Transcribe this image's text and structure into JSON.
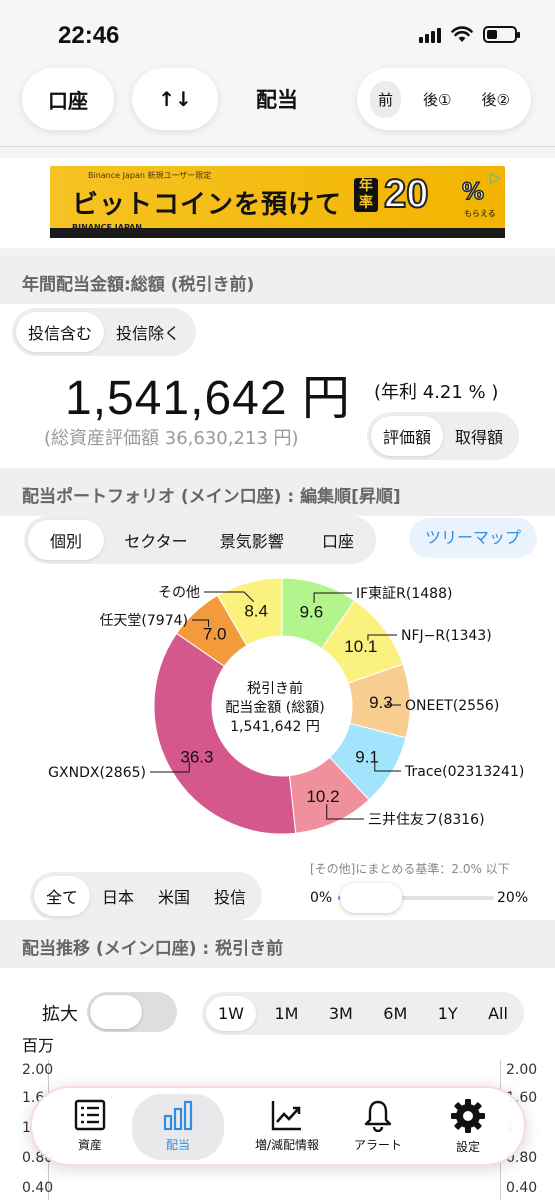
{
  "status": {
    "time": "22:46"
  },
  "header": {
    "account_label": "口座",
    "sort_label": "↑↓",
    "title": "配当",
    "tax_tabs": [
      {
        "label": "前",
        "active": true
      },
      {
        "label": "後①",
        "active": false
      },
      {
        "label": "後②",
        "active": false
      }
    ]
  },
  "ad": {
    "small_text": "Binance Japan 新規ユーザー限定",
    "headline": "ビットコインを預けて",
    "badge_char": "年率",
    "percent": "20",
    "percent_sign": "%",
    "sub": "もらえる",
    "brand": "BINANCE JAPAN"
  },
  "annual": {
    "section_title": "年間配当金額:総額 (税引き前)",
    "fund_tabs": [
      {
        "label": "投信含む",
        "active": true
      },
      {
        "label": "投信除く",
        "active": false
      }
    ],
    "total": "1,541,642 円",
    "yield": "(年利 4.21 % )",
    "assets": "(総資産評価額 36,630,213 円)",
    "value_tabs": [
      {
        "label": "評価額",
        "active": true
      },
      {
        "label": "取得額",
        "active": false
      }
    ]
  },
  "portfolio": {
    "section_title": "配当ポートフォリオ (メイン口座) : 編集順[昇順]",
    "view_tabs": [
      {
        "label": "個別",
        "active": true
      },
      {
        "label": "セクター",
        "active": false
      },
      {
        "label": "景気影響",
        "active": false
      },
      {
        "label": "口座",
        "active": false
      }
    ],
    "treemap_label": "ツリーマップ",
    "center_line1": "税引き前",
    "center_line2": "配当金額 (総額)",
    "center_line3": "1,541,642 円",
    "region_tabs": [
      {
        "label": "全て",
        "active": true
      },
      {
        "label": "日本",
        "active": false
      },
      {
        "label": "米国",
        "active": false
      },
      {
        "label": "投信",
        "active": false
      }
    ],
    "threshold_label": "[その他]にまとめる基準：2.0% 以下",
    "slider_min": "0%",
    "slider_max": "20%",
    "slider_value": 0.02
  },
  "chart_data": {
    "type": "pie",
    "title": "",
    "slices": [
      {
        "label": "IF東証R(1488)",
        "value": 9.6,
        "color": "#b4f48c"
      },
      {
        "label": "NFJ−R(1343)",
        "value": 10.1,
        "color": "#fbf17e"
      },
      {
        "label": "ONEET(2556)",
        "value": 9.3,
        "color": "#f8cd90"
      },
      {
        "label": "Trace(02313241)",
        "value": 9.1,
        "color": "#a2e4fb"
      },
      {
        "label": "三井住友フ(8316)",
        "value": 10.2,
        "color": "#f0909c"
      },
      {
        "label": "GXNDX(2865)",
        "value": 36.3,
        "color": "#d4588c"
      },
      {
        "label": "任天堂(7974)",
        "value": 7.0,
        "color": "#f29a3c"
      },
      {
        "label": "その他",
        "value": 8.4,
        "color": "#fbf17e"
      }
    ]
  },
  "trend": {
    "section_title": "配当推移 (メイン口座) : 税引き前",
    "zoom_label": "拡大",
    "range_tabs": [
      {
        "label": "1W",
        "active": true
      },
      {
        "label": "1M",
        "active": false
      },
      {
        "label": "3M",
        "active": false
      },
      {
        "label": "6M",
        "active": false
      },
      {
        "label": "1Y",
        "active": false
      },
      {
        "label": "All",
        "active": false
      }
    ],
    "unit": "百万",
    "y_left": [
      "2.00",
      "1.6",
      "1",
      "0.80",
      "0.40"
    ],
    "y_right": [
      "2.00",
      "1.60",
      "1",
      "0.80",
      "0.40"
    ]
  },
  "nav": {
    "items": [
      {
        "label": "資産",
        "icon": "list-icon",
        "active": false
      },
      {
        "label": "配当",
        "icon": "bar-chart-icon",
        "active": true
      },
      {
        "label": "増/減配情報",
        "icon": "trend-icon",
        "active": false
      },
      {
        "label": "アラート",
        "icon": "bell-icon",
        "active": false
      },
      {
        "label": "設定",
        "icon": "gear-icon",
        "active": false
      }
    ],
    "active_color": "#2f8de4"
  }
}
